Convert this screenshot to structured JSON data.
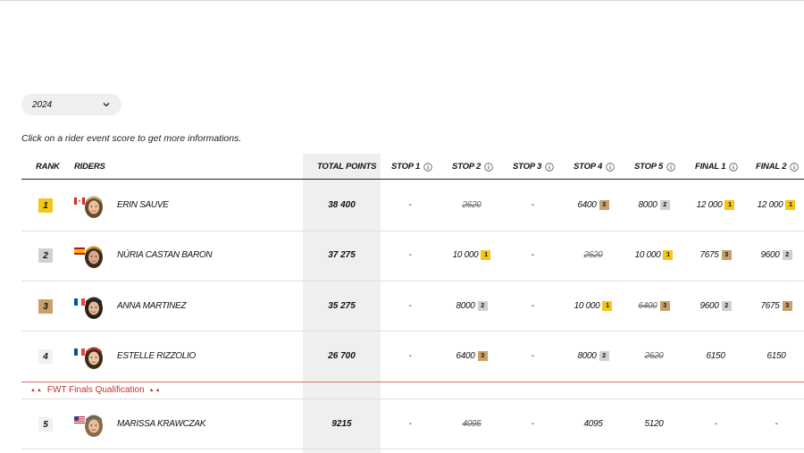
{
  "filter": {
    "year": "2024"
  },
  "hint": "Click on a rider event score to get more informations.",
  "columns": {
    "rank": "RANK",
    "riders": "RIDERS",
    "total": "TOTAL POINTS",
    "stop1": "STOP 1",
    "stop2": "STOP 2",
    "stop3": "STOP 3",
    "stop4": "STOP 4",
    "stop5": "STOP 5",
    "final1": "FINAL 1",
    "final2": "FINAL 2"
  },
  "qualification_label": "FWT Finals Qualification",
  "colors": {
    "gold": "#f4c619",
    "silver": "#cfd0d2",
    "bronze": "#c9a06a",
    "qualification": "#c7312f"
  },
  "rows": [
    {
      "rank": "1",
      "name": "Erin Sauve",
      "flag": "canada-flag",
      "total": "38 400",
      "scores": [
        {
          "v": "-"
        },
        {
          "v": "2620",
          "struck": true
        },
        {
          "v": "-"
        },
        {
          "v": "6400",
          "badge": "3"
        },
        {
          "v": "8000",
          "badge": "2"
        },
        {
          "v": "12 000",
          "badge": "1"
        },
        {
          "v": "12 000",
          "badge": "1"
        }
      ]
    },
    {
      "rank": "2",
      "name": "Núria Castan Baron",
      "flag": "spain-flag",
      "total": "37 275",
      "scores": [
        {
          "v": "-"
        },
        {
          "v": "10 000",
          "badge": "1"
        },
        {
          "v": "-"
        },
        {
          "v": "2620",
          "struck": true
        },
        {
          "v": "10 000",
          "badge": "1"
        },
        {
          "v": "7675",
          "badge": "3"
        },
        {
          "v": "9600",
          "badge": "2"
        }
      ]
    },
    {
      "rank": "3",
      "name": "Anna Martinez",
      "flag": "france-flag",
      "total": "35 275",
      "scores": [
        {
          "v": "-"
        },
        {
          "v": "8000",
          "badge": "2"
        },
        {
          "v": "-"
        },
        {
          "v": "10 000",
          "badge": "1"
        },
        {
          "v": "6400",
          "badge": "3",
          "struck": true
        },
        {
          "v": "9600",
          "badge": "2"
        },
        {
          "v": "7675",
          "badge": "3"
        }
      ]
    },
    {
      "rank": "4",
      "name": "Estelle Rizzolio",
      "flag": "france-flag",
      "total": "26 700",
      "scores": [
        {
          "v": "-"
        },
        {
          "v": "6400",
          "badge": "3"
        },
        {
          "v": "-"
        },
        {
          "v": "8000",
          "badge": "2"
        },
        {
          "v": "2620",
          "struck": true
        },
        {
          "v": "6150"
        },
        {
          "v": "6150"
        }
      ]
    },
    {
      "rank": "5",
      "name": "Marissa Krawczak",
      "flag": "usa-flag",
      "total": "9215",
      "scores": [
        {
          "v": "-"
        },
        {
          "v": "4095",
          "struck": true
        },
        {
          "v": "-"
        },
        {
          "v": "4095"
        },
        {
          "v": "5120"
        },
        {
          "v": "-"
        },
        {
          "v": "-"
        }
      ]
    }
  ]
}
